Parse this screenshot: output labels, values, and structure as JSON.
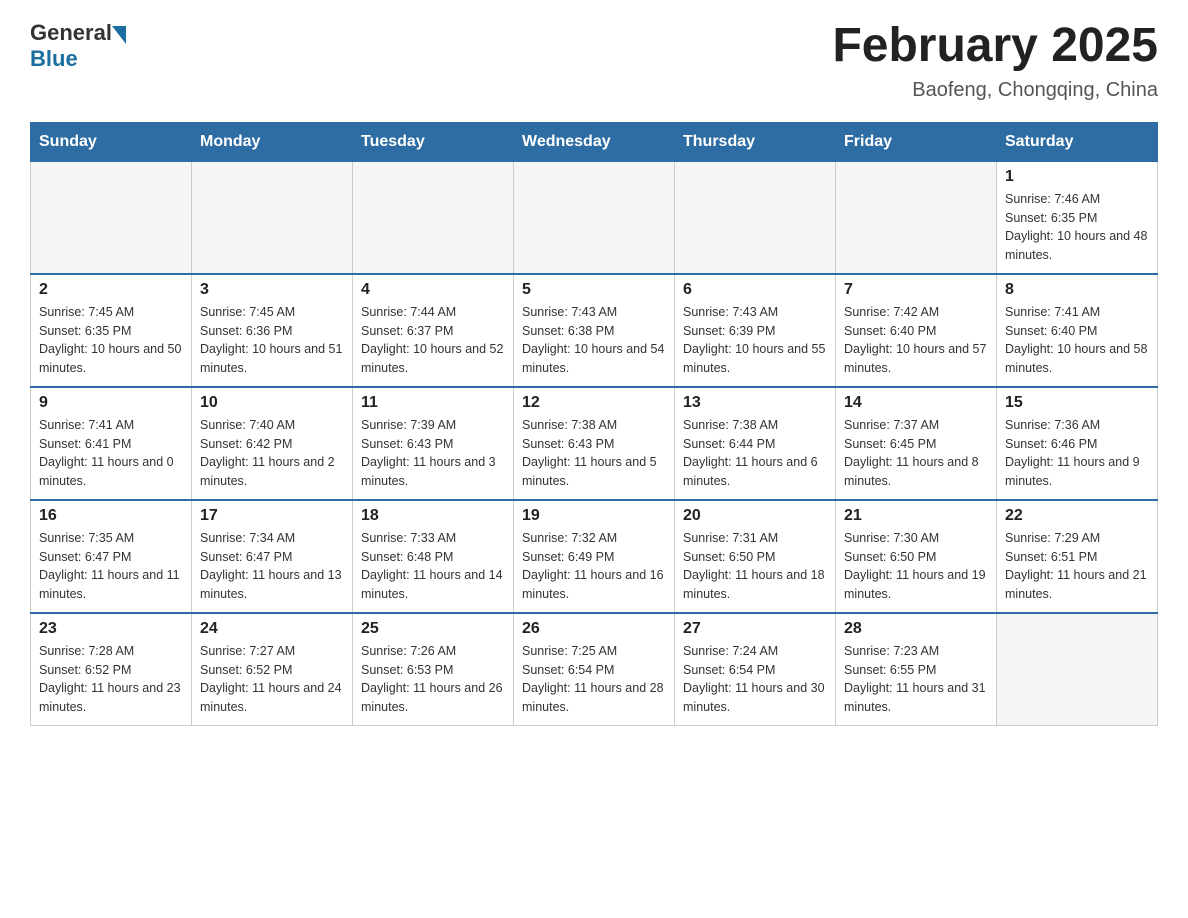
{
  "header": {
    "logo": {
      "general": "General",
      "blue": "Blue"
    },
    "title": "February 2025",
    "location": "Baofeng, Chongqing, China"
  },
  "days_of_week": [
    "Sunday",
    "Monday",
    "Tuesday",
    "Wednesday",
    "Thursday",
    "Friday",
    "Saturday"
  ],
  "weeks": [
    {
      "days": [
        {
          "num": "",
          "empty": true
        },
        {
          "num": "",
          "empty": true
        },
        {
          "num": "",
          "empty": true
        },
        {
          "num": "",
          "empty": true
        },
        {
          "num": "",
          "empty": true
        },
        {
          "num": "",
          "empty": true
        },
        {
          "num": "1",
          "sunrise": "7:46 AM",
          "sunset": "6:35 PM",
          "daylight": "10 hours and 48 minutes."
        }
      ]
    },
    {
      "days": [
        {
          "num": "2",
          "sunrise": "7:45 AM",
          "sunset": "6:35 PM",
          "daylight": "10 hours and 50 minutes."
        },
        {
          "num": "3",
          "sunrise": "7:45 AM",
          "sunset": "6:36 PM",
          "daylight": "10 hours and 51 minutes."
        },
        {
          "num": "4",
          "sunrise": "7:44 AM",
          "sunset": "6:37 PM",
          "daylight": "10 hours and 52 minutes."
        },
        {
          "num": "5",
          "sunrise": "7:43 AM",
          "sunset": "6:38 PM",
          "daylight": "10 hours and 54 minutes."
        },
        {
          "num": "6",
          "sunrise": "7:43 AM",
          "sunset": "6:39 PM",
          "daylight": "10 hours and 55 minutes."
        },
        {
          "num": "7",
          "sunrise": "7:42 AM",
          "sunset": "6:40 PM",
          "daylight": "10 hours and 57 minutes."
        },
        {
          "num": "8",
          "sunrise": "7:41 AM",
          "sunset": "6:40 PM",
          "daylight": "10 hours and 58 minutes."
        }
      ]
    },
    {
      "days": [
        {
          "num": "9",
          "sunrise": "7:41 AM",
          "sunset": "6:41 PM",
          "daylight": "11 hours and 0 minutes."
        },
        {
          "num": "10",
          "sunrise": "7:40 AM",
          "sunset": "6:42 PM",
          "daylight": "11 hours and 2 minutes."
        },
        {
          "num": "11",
          "sunrise": "7:39 AM",
          "sunset": "6:43 PM",
          "daylight": "11 hours and 3 minutes."
        },
        {
          "num": "12",
          "sunrise": "7:38 AM",
          "sunset": "6:43 PM",
          "daylight": "11 hours and 5 minutes."
        },
        {
          "num": "13",
          "sunrise": "7:38 AM",
          "sunset": "6:44 PM",
          "daylight": "11 hours and 6 minutes."
        },
        {
          "num": "14",
          "sunrise": "7:37 AM",
          "sunset": "6:45 PM",
          "daylight": "11 hours and 8 minutes."
        },
        {
          "num": "15",
          "sunrise": "7:36 AM",
          "sunset": "6:46 PM",
          "daylight": "11 hours and 9 minutes."
        }
      ]
    },
    {
      "days": [
        {
          "num": "16",
          "sunrise": "7:35 AM",
          "sunset": "6:47 PM",
          "daylight": "11 hours and 11 minutes."
        },
        {
          "num": "17",
          "sunrise": "7:34 AM",
          "sunset": "6:47 PM",
          "daylight": "11 hours and 13 minutes."
        },
        {
          "num": "18",
          "sunrise": "7:33 AM",
          "sunset": "6:48 PM",
          "daylight": "11 hours and 14 minutes."
        },
        {
          "num": "19",
          "sunrise": "7:32 AM",
          "sunset": "6:49 PM",
          "daylight": "11 hours and 16 minutes."
        },
        {
          "num": "20",
          "sunrise": "7:31 AM",
          "sunset": "6:50 PM",
          "daylight": "11 hours and 18 minutes."
        },
        {
          "num": "21",
          "sunrise": "7:30 AM",
          "sunset": "6:50 PM",
          "daylight": "11 hours and 19 minutes."
        },
        {
          "num": "22",
          "sunrise": "7:29 AM",
          "sunset": "6:51 PM",
          "daylight": "11 hours and 21 minutes."
        }
      ]
    },
    {
      "days": [
        {
          "num": "23",
          "sunrise": "7:28 AM",
          "sunset": "6:52 PM",
          "daylight": "11 hours and 23 minutes."
        },
        {
          "num": "24",
          "sunrise": "7:27 AM",
          "sunset": "6:52 PM",
          "daylight": "11 hours and 24 minutes."
        },
        {
          "num": "25",
          "sunrise": "7:26 AM",
          "sunset": "6:53 PM",
          "daylight": "11 hours and 26 minutes."
        },
        {
          "num": "26",
          "sunrise": "7:25 AM",
          "sunset": "6:54 PM",
          "daylight": "11 hours and 28 minutes."
        },
        {
          "num": "27",
          "sunrise": "7:24 AM",
          "sunset": "6:54 PM",
          "daylight": "11 hours and 30 minutes."
        },
        {
          "num": "28",
          "sunrise": "7:23 AM",
          "sunset": "6:55 PM",
          "daylight": "11 hours and 31 minutes."
        },
        {
          "num": "",
          "empty": true
        }
      ]
    }
  ]
}
